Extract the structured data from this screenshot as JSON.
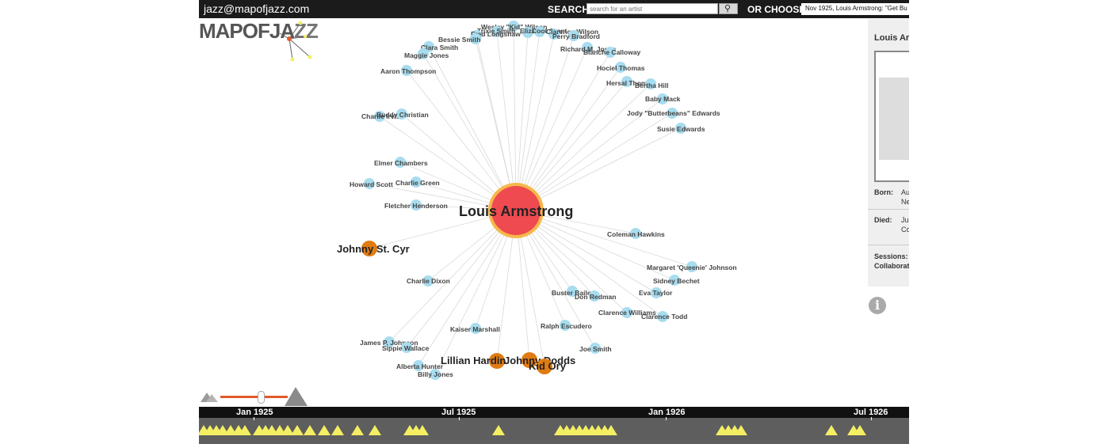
{
  "topbar": {
    "email": "jazz@mapofjazz.com",
    "search_label": "SEARCH",
    "search_placeholder": "search for an artist",
    "or_choose_label": "OR CHOOSE",
    "choose_value": "Nov 1925, Louis Armstrong: \"Get Bu"
  },
  "logo": {
    "text_a": "MAPOFJA",
    "text_b": "ZZ"
  },
  "graph": {
    "center": {
      "name": "Louis Armstrong"
    },
    "highlight_nodes": [
      {
        "name": "Johnny St. Cyr"
      },
      {
        "name": "Lillian Hardin"
      },
      {
        "name": "Johnny Dodds"
      },
      {
        "name": "Kid Ory"
      }
    ],
    "nodes": [
      "Wesley \"Kid\" Wilson",
      "Trixie Smith",
      "Eliza B.",
      "Coot Grant",
      "Clarence Wilson",
      "Fred Longshaw",
      "Bessie Smith",
      "Perry Bradford",
      "Clara Smith",
      "Maggie Jones",
      "Richard M. Jones",
      "Blanche Calloway",
      "Aaron Thompson",
      "Hociel Thomas",
      "Hersal Thomas",
      "Bertha Hill",
      "Baby Mack",
      "Charlie Irvis",
      "Buddy Christian",
      "Jody \"Butterbeans\" Edwards",
      "Susie Edwards",
      "Elmer Chambers",
      "Howard Scott",
      "Charlie Green",
      "Fletcher Henderson",
      "Coleman Hawkins",
      "Margaret 'Queenie' Johnson",
      "Sidney Bechet",
      "Charlie Dixon",
      "Eva Taylor",
      "Buster Bailey",
      "Don Redman",
      "Clarence Williams",
      "Clarence Todd",
      "Kaiser Marshall",
      "Ralph Escudero",
      "James P. Johnson",
      "Sippie Wallace",
      "Joe Smith",
      "Alberta Hunter",
      "Billy Jones"
    ]
  },
  "panel": {
    "name": "Louis Arm",
    "born_label": "Born:",
    "born_value_1": "Au",
    "born_value_2": "Ne",
    "died_label": "Died:",
    "died_value_1": "Ju",
    "died_value_2": "Co",
    "sessions_label": "Sessions:",
    "collab_label": "Collaborat"
  },
  "zoom": {
    "level": 0.59
  },
  "timeline": {
    "labels": [
      "Jan 1925",
      "Jul 1925",
      "Jan 1926",
      "Jul 1926"
    ]
  },
  "colors": {
    "center_fill": "#ef4a50",
    "center_ring": "#f6b84a",
    "highlight": "#e07b12",
    "node": "#a8dcef",
    "edge": "#d9d9d9",
    "session_marker": "#f4ee63"
  }
}
